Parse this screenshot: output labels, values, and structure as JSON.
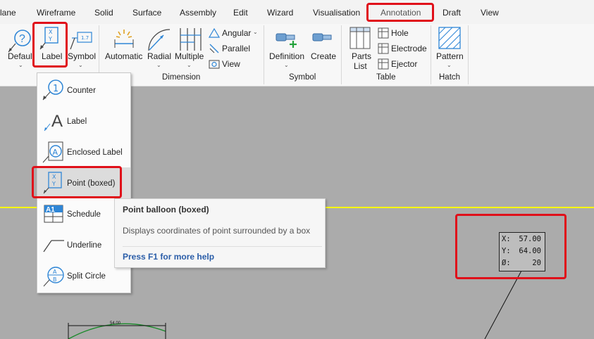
{
  "tabs": [
    "lane",
    "Wireframe",
    "Solid",
    "Surface",
    "Assembly",
    "Edit",
    "Wizard",
    "Visualisation",
    "Annotation",
    "Draft",
    "View"
  ],
  "ribbon": {
    "default_label": "Default",
    "label_label": "Label",
    "symbol_label": "Symbol",
    "automatic_label": "Automatic",
    "radial_label": "Radial",
    "multiple_label": "Multiple",
    "angular_label": "Angular",
    "parallel_label": "Parallel",
    "view_label": "View",
    "dimension_group": "Dimension",
    "definition_label": "Definition",
    "create_label": "Create",
    "symbol_group": "Symbol",
    "parts_list_line1": "Parts",
    "parts_list_line2": "List",
    "hole_label": "Hole",
    "electrode_label": "Electrode",
    "ejector_label": "Ejector",
    "table_group": "Table",
    "pattern_label": "Pattern",
    "hatch_group": "Hatch"
  },
  "menu": {
    "items": [
      "Counter",
      "Label",
      "Enclosed Label",
      "Point (boxed)",
      "Schedule",
      "Underline",
      "Split Circle"
    ]
  },
  "tooltip": {
    "title": "Point balloon (boxed)",
    "description": "Displays coordinates of point surrounded by a box",
    "help": "Press F1 for more help"
  },
  "coordinate_box": {
    "rows": [
      {
        "key": "X:",
        "value": "57.00"
      },
      {
        "key": "Y:",
        "value": "64.00"
      },
      {
        "key": "Ø:",
        "value": "20"
      }
    ]
  },
  "drawing": {
    "dimension_text": "54.00"
  },
  "colors": {
    "highlight": "#e0101a",
    "axis_line": "#ffff00",
    "canvas": "#ababab",
    "icon_blue": "#2f86d6"
  }
}
